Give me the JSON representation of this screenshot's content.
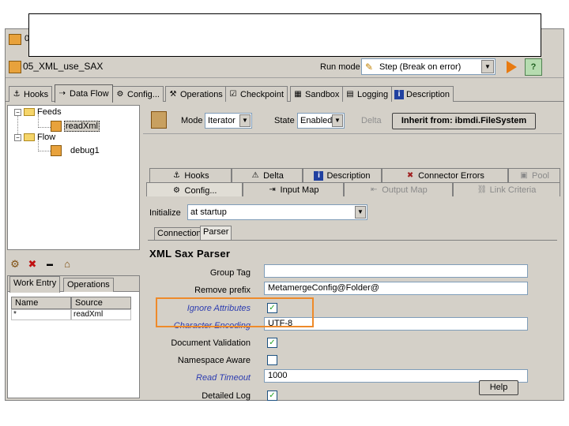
{
  "window": {
    "title_char": "0",
    "project_title": "05_XML_use_SAX"
  },
  "run_mode": {
    "label": "Run mode",
    "value": "Step (Break on error)"
  },
  "main_tabs": [
    {
      "label": "Hooks"
    },
    {
      "label": "Data Flow"
    },
    {
      "label": "Config..."
    },
    {
      "label": "Operations"
    },
    {
      "label": "Checkpoint"
    },
    {
      "label": "Sandbox"
    },
    {
      "label": "Logging"
    },
    {
      "label": "Description"
    }
  ],
  "tree": {
    "feeds_label": "Feeds",
    "feeds_child": "readXml",
    "flow_label": "Flow",
    "flow_child": "debug1"
  },
  "lower_left": {
    "tabs": [
      {
        "label": "Work Entry"
      },
      {
        "label": "Operations"
      }
    ],
    "columns": [
      "Name",
      "Source"
    ],
    "rows": [
      {
        "name": "*",
        "source": "readXml"
      }
    ]
  },
  "connector_toolbar": {
    "mode_label": "Mode",
    "mode_value": "Iterator",
    "state_label": "State",
    "state_value": "Enabled",
    "delta_label": "Delta",
    "inherit_button": "Inherit from: ibmdi.FileSystem"
  },
  "connector_tabs_row1": [
    {
      "label": "Hooks"
    },
    {
      "label": "Delta"
    },
    {
      "label": "Description"
    },
    {
      "label": "Connector Errors"
    },
    {
      "label": "Pool"
    }
  ],
  "connector_tabs_row2": [
    {
      "label": "Config..."
    },
    {
      "label": "Input Map"
    },
    {
      "label": "Output Map"
    },
    {
      "label": "Link Criteria"
    }
  ],
  "initialize": {
    "label": "Initialize",
    "value": "at startup"
  },
  "sub_tabs": [
    {
      "label": "Connection"
    },
    {
      "label": "Parser"
    }
  ],
  "parser": {
    "title": "XML Sax Parser",
    "group_tag_label": "Group Tag",
    "group_tag_value": "",
    "remove_prefix_label": "Remove prefix",
    "remove_prefix_value": "MetamergeConfig@Folder@",
    "ignore_attributes_label": "Ignore Attributes",
    "ignore_attributes_checked": true,
    "character_encoding_label": "Character Encoding",
    "character_encoding_value": "UTF-8",
    "document_validation_label": "Document Validation",
    "document_validation_checked": true,
    "namespace_aware_label": "Namespace Aware",
    "namespace_aware_checked": false,
    "read_timeout_label": "Read Timeout",
    "read_timeout_value": "1000",
    "detailed_log_label": "Detailed Log",
    "detailed_log_checked": true,
    "help_label": "Help"
  },
  "colors": {
    "highlight": "#ee8a2a",
    "italic_label": "#2c3cb0",
    "check": "#21a121",
    "panel_bg": "#d4d0c8"
  }
}
